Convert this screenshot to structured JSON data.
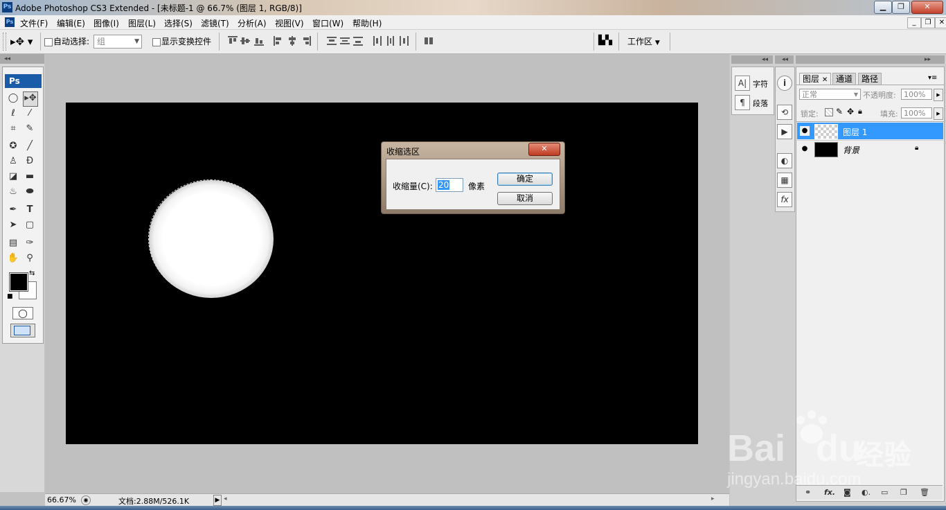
{
  "window": {
    "title": "Adobe Photoshop CS3 Extended - [未标题-1 @ 66.7% (图层 1, RGB/8)]",
    "app_icon": "Ps",
    "controls": [
      "minimize-icon",
      "maximize-icon",
      "close-icon"
    ]
  },
  "menu": {
    "items": [
      "文件(F)",
      "编辑(E)",
      "图像(I)",
      "图层(L)",
      "选择(S)",
      "滤镜(T)",
      "分析(A)",
      "视图(V)",
      "窗口(W)",
      "帮助(H)"
    ],
    "doc_controls": [
      "_",
      "❐",
      "✕"
    ]
  },
  "options": {
    "auto_select_label": "自动选择:",
    "auto_select_value": "组",
    "show_transform_label": "显示变换控件",
    "workspace_label": "工作区"
  },
  "toolbox": {
    "logo": "Ps"
  },
  "dialog": {
    "title": "收缩选区",
    "label": "收缩量(C):",
    "value": "20",
    "unit": "像素",
    "ok": "确定",
    "cancel": "取消"
  },
  "status": {
    "zoom": "66.67%",
    "doc_info": "文档:2.88M/526.1K"
  },
  "char_panel": {
    "character": "字符",
    "paragraph": "段落"
  },
  "layers_panel": {
    "tabs": [
      "图层",
      "通道",
      "路径"
    ],
    "blend_mode": "正常",
    "opacity_label": "不透明度:",
    "opacity_value": "100%",
    "lock_label": "锁定:",
    "fill_label": "填充:",
    "fill_value": "100%",
    "layers": [
      {
        "name": "图层 1",
        "selected": true
      },
      {
        "name": "背景",
        "selected": false,
        "locked": true
      }
    ]
  },
  "watermark": {
    "brand": "Bai",
    "brand2": "du",
    "cn": "经验",
    "url": "jingyan.baidu.com"
  }
}
